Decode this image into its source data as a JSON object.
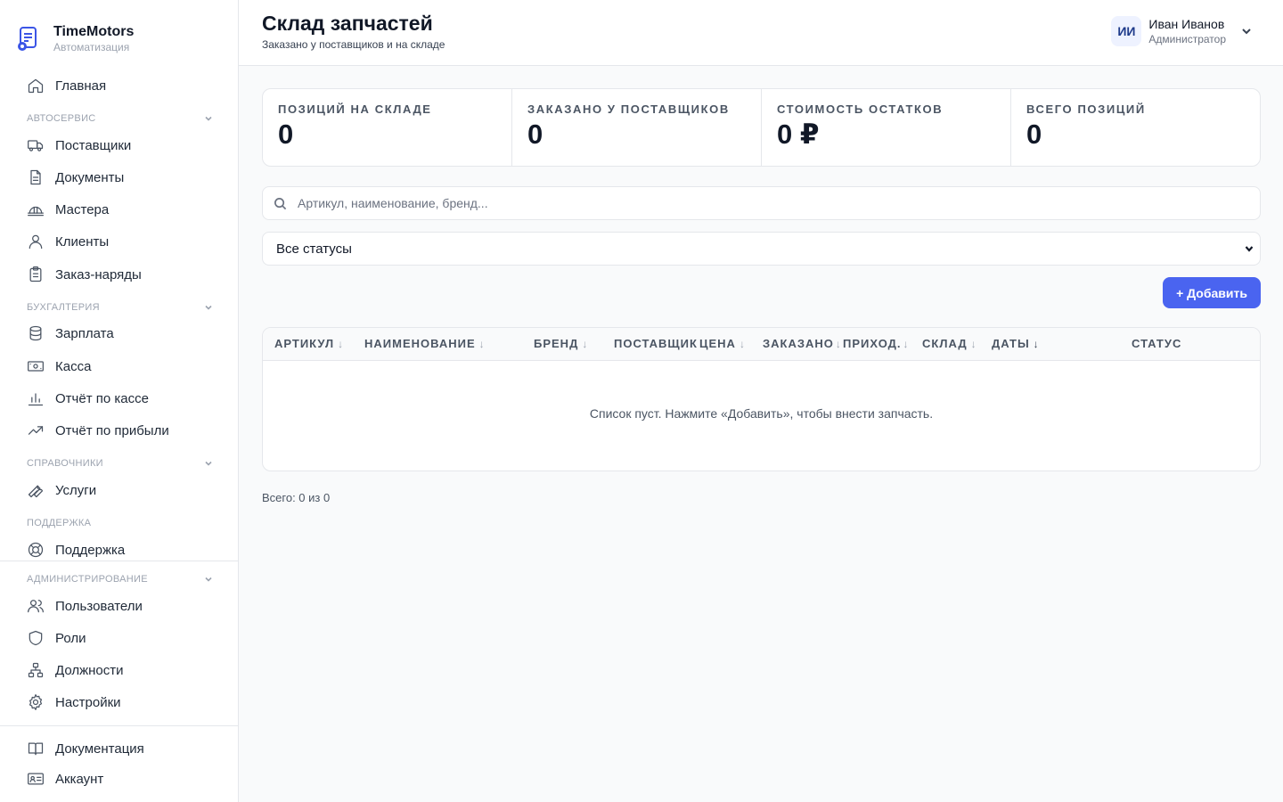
{
  "brand": {
    "name": "TimeMotors",
    "subtitle": "Автоматизация"
  },
  "nav": {
    "home": "Главная",
    "sections": {
      "autoservice": "АВТОСЕРВИС",
      "accounting": "БУХГАЛТЕРИЯ",
      "references": "СПРАВОЧНИКИ",
      "support": "ПОДДЕРЖКА",
      "admin": "АДМИНИСТРИРОВАНИЕ"
    },
    "items": {
      "suppliers": "Поставщики",
      "documents": "Документы",
      "masters": "Мастера",
      "clients": "Клиенты",
      "work_orders": "Заказ-наряды",
      "salary": "Зарплата",
      "cash": "Касса",
      "cash_report": "Отчёт по кассе",
      "profit_report": "Отчёт по прибыли",
      "services": "Услуги",
      "support": "Поддержка",
      "users": "Пользователи",
      "roles": "Роли",
      "positions": "Должности",
      "settings": "Настройки",
      "docs": "Документация",
      "account": "Аккаунт"
    }
  },
  "header": {
    "title": "Склад запчастей",
    "subtitle": "Заказано у поставщиков и на складе",
    "user": {
      "initials": "ИИ",
      "name": "Иван Иванов",
      "role": "Администратор"
    }
  },
  "stats": [
    {
      "label": "ПОЗИЦИЙ НА СКЛАДЕ",
      "value": "0"
    },
    {
      "label": "ЗАКАЗАНО У ПОСТАВЩИКОВ",
      "value": "0"
    },
    {
      "label": "СТОИМОСТЬ ОСТАТКОВ",
      "value": "0 ₽"
    },
    {
      "label": "ВСЕГО ПОЗИЦИЙ",
      "value": "0"
    }
  ],
  "search": {
    "placeholder": "Артикул, наименование, бренд..."
  },
  "filter": {
    "selected": "Все статусы"
  },
  "add_button": "+ Добавить",
  "table": {
    "columns": {
      "article": "АРТИКУЛ",
      "name": "НАИМЕНОВАНИЕ",
      "brand": "БРЕНД",
      "supplier": "ПОСТАВЩИК",
      "price": "ЦЕНА",
      "ordered": "ЗАКАЗАНО",
      "received": "ПРИХОД.",
      "warehouse": "СКЛАД",
      "dates": "ДАТЫ",
      "status": "СТАТУС"
    },
    "sort_arrow": "↓",
    "empty": "Список пуст. Нажмите «Добавить», чтобы внести запчасть."
  },
  "footer": {
    "total": "Всего: 0 из 0"
  },
  "colors": {
    "accent": "#4a64f0"
  }
}
